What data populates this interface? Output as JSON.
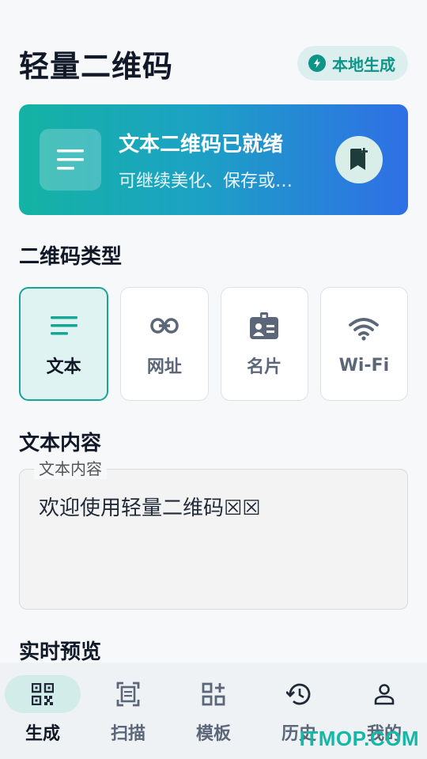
{
  "header": {
    "title": "轻量二维码",
    "badge": "本地生成",
    "badge_icon": "bolt-icon"
  },
  "banner": {
    "title": "文本二维码已就绪",
    "subtitle": "可继续美化、保存或…",
    "icon": "text-lines-icon",
    "action_icon": "bookmark-add-icon"
  },
  "type_section": {
    "title": "二维码类型"
  },
  "types": [
    {
      "label": "文本",
      "icon": "text-lines-icon",
      "selected": true
    },
    {
      "label": "网址",
      "icon": "link-icon",
      "selected": false
    },
    {
      "label": "名片",
      "icon": "contact-card-icon",
      "selected": false
    },
    {
      "label": "Wi-Fi",
      "icon": "wifi-icon",
      "selected": false
    }
  ],
  "content_section": {
    "title": "文本内容",
    "field_label": "文本内容",
    "field_value": "欢迎使用轻量二维码☒☒"
  },
  "preview_section": {
    "title": "实时预览"
  },
  "nav": [
    {
      "label": "生成",
      "icon": "qr-code-icon",
      "active": true
    },
    {
      "label": "扫描",
      "icon": "scan-icon",
      "active": false
    },
    {
      "label": "模板",
      "icon": "widgets-icon",
      "active": false
    },
    {
      "label": "历史",
      "icon": "history-icon",
      "active": false
    },
    {
      "label": "我的",
      "icon": "person-icon",
      "active": false
    }
  ],
  "watermark": "ITMOP.COM",
  "colors": {
    "accent": "#17a596",
    "gradient_start": "#14b3a3",
    "gradient_end": "#2f6fe6"
  }
}
